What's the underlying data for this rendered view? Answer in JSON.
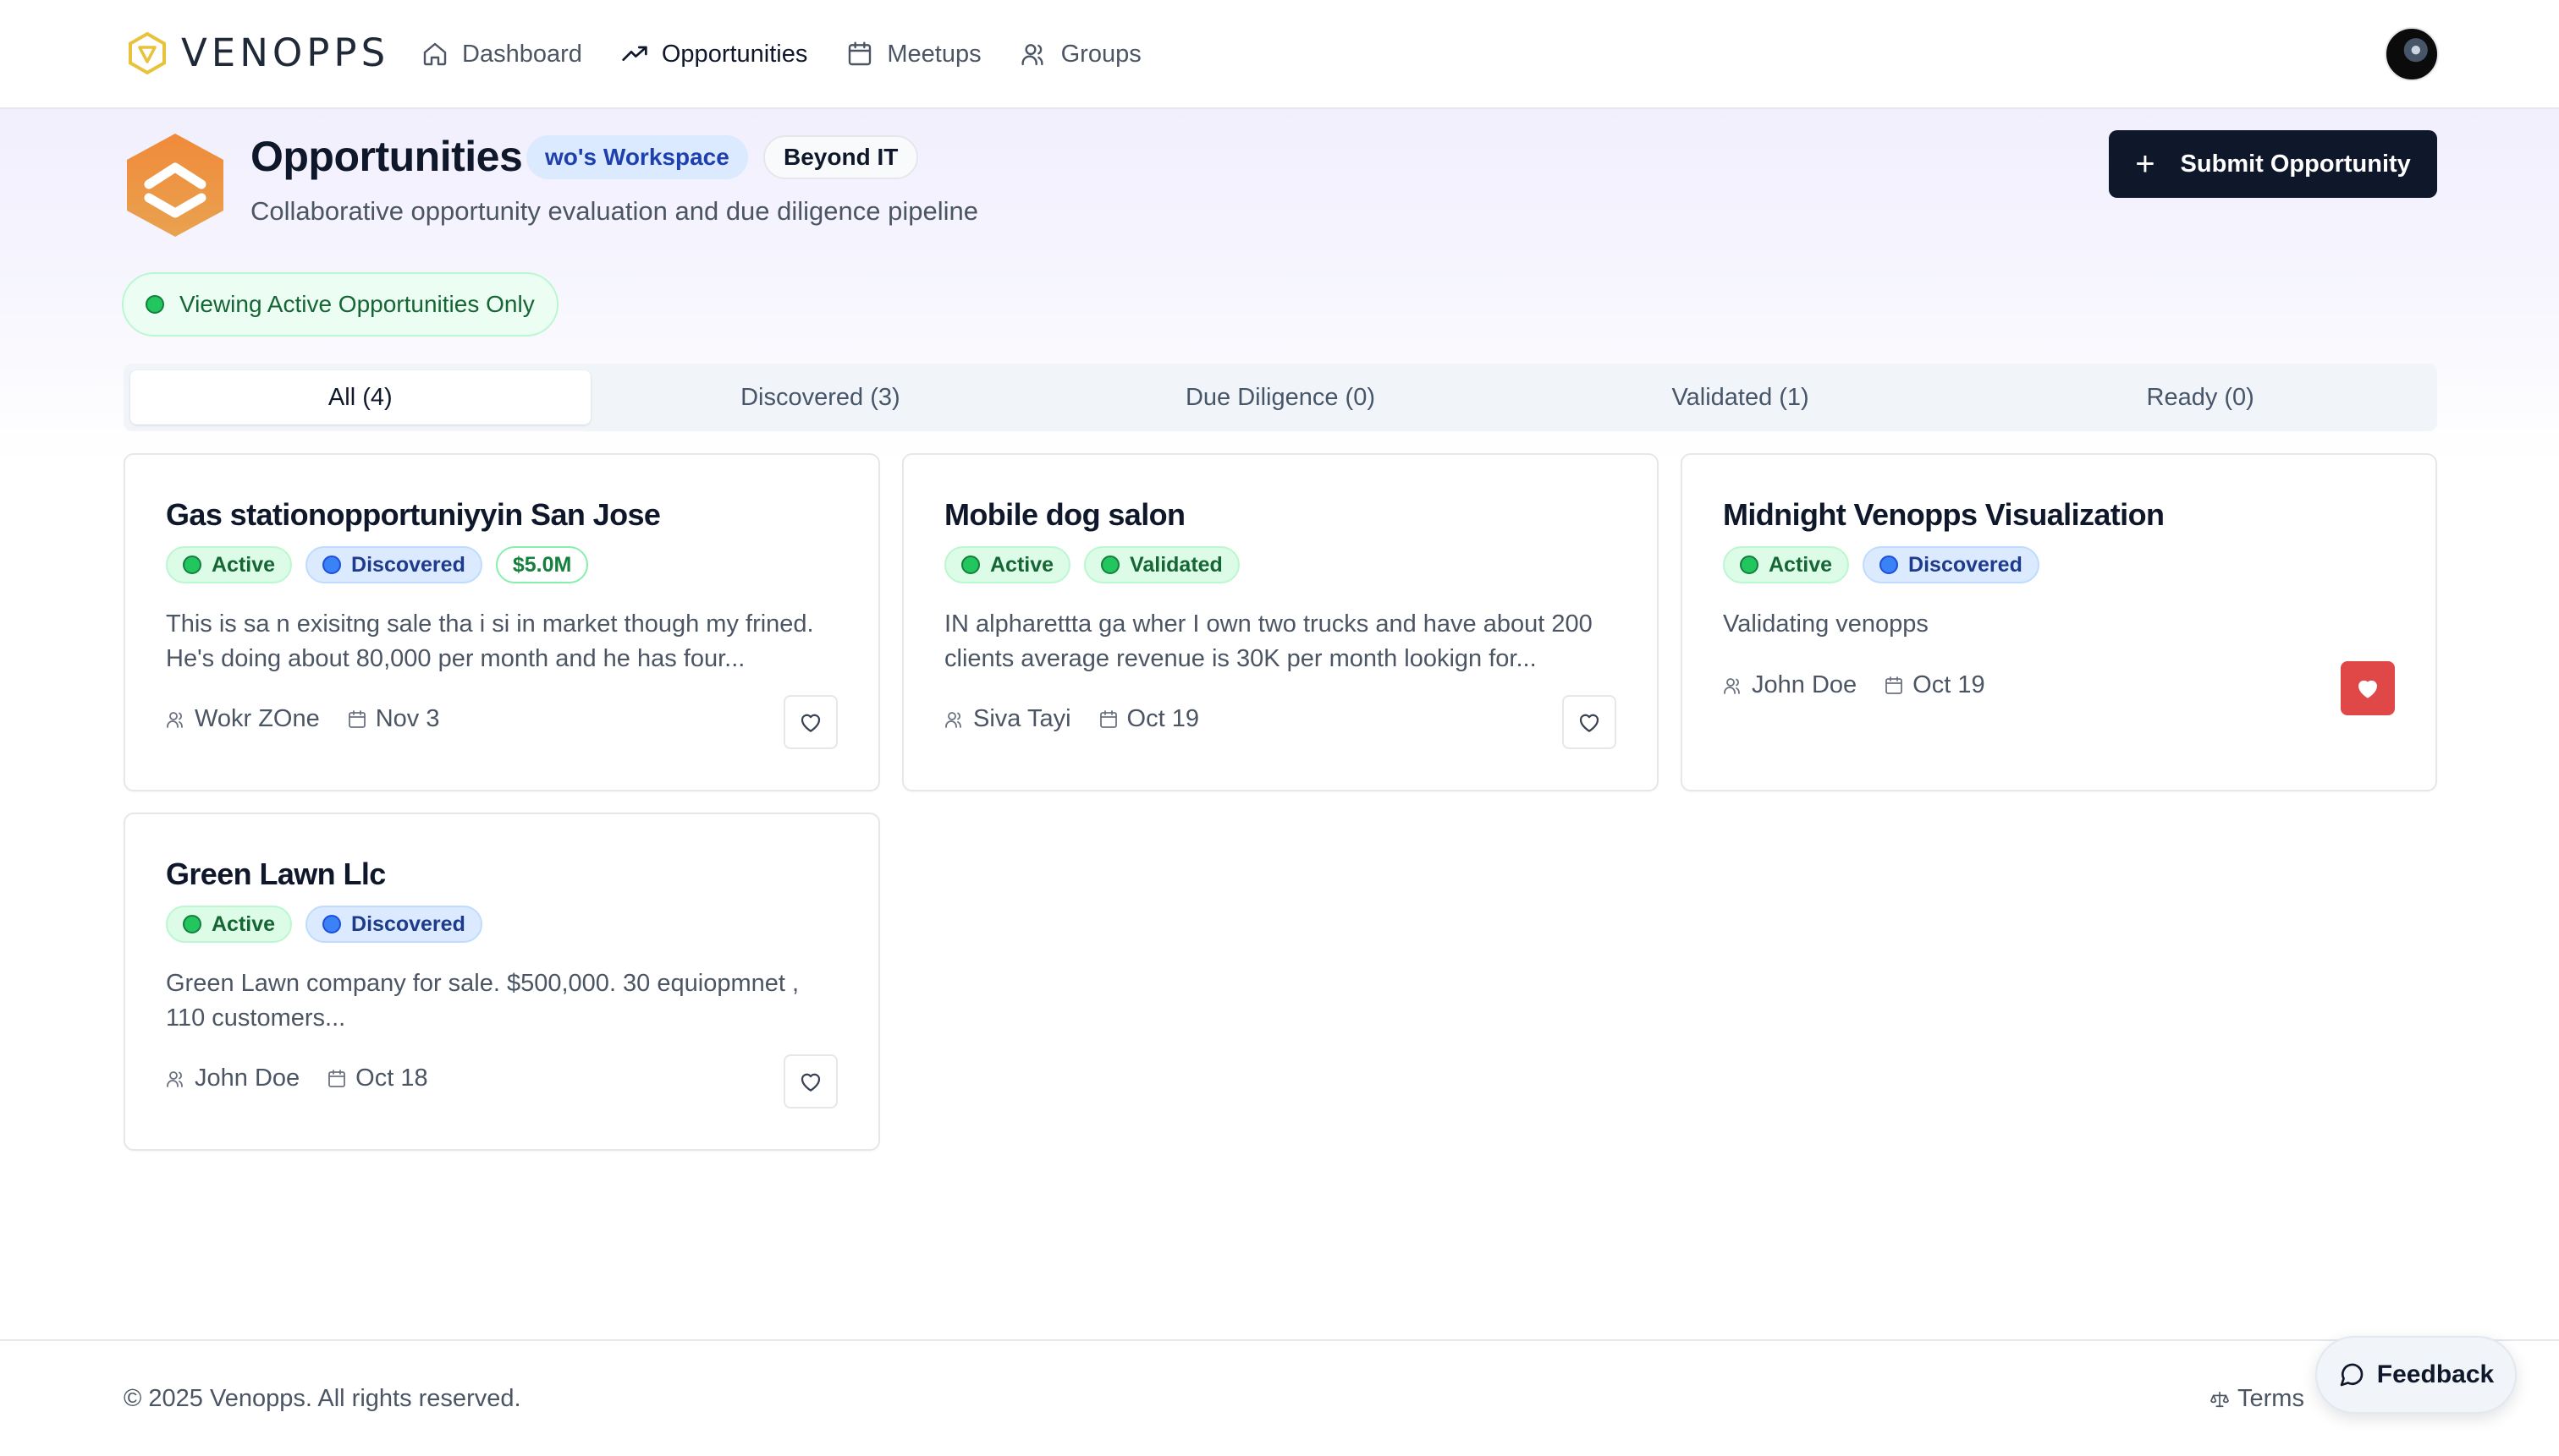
{
  "nav": {
    "brand": "VENOPPS",
    "links": [
      {
        "label": "Dashboard",
        "icon": "home-icon"
      },
      {
        "label": "Opportunities",
        "icon": "trending-up-icon"
      },
      {
        "label": "Meetups",
        "icon": "calendar-icon"
      },
      {
        "label": "Groups",
        "icon": "users-icon"
      }
    ],
    "active_link": "Opportunities"
  },
  "header": {
    "title": "Opportunities",
    "workspace_pill": "wo's Workspace",
    "group_pill": "Beyond IT",
    "subtitle": "Collaborative opportunity evaluation and due diligence pipeline",
    "submit_label": "Submit Opportunity",
    "status_chip": "Viewing Active Opportunities Only"
  },
  "tabs": [
    {
      "label": "All (4)",
      "active": true
    },
    {
      "label": "Discovered (3)",
      "active": false
    },
    {
      "label": "Due Diligence (0)",
      "active": false
    },
    {
      "label": "Validated (1)",
      "active": false
    },
    {
      "label": "Ready (0)",
      "active": false
    }
  ],
  "cards": [
    {
      "title": "Gas stationopportuniyyin San Jose",
      "badges": [
        {
          "label": "Active",
          "kind": "active"
        },
        {
          "label": "Discovered",
          "kind": "discovered"
        },
        {
          "label": "$5.0M",
          "kind": "amount"
        }
      ],
      "description": "This is sa n exisitng sale tha i si in market though my frined. He's doing about 80,000 per month and he has four...",
      "owner": "Wokr ZOne",
      "date": "Nov 3",
      "favorited": false
    },
    {
      "title": "Mobile dog salon",
      "badges": [
        {
          "label": "Active",
          "kind": "active"
        },
        {
          "label": "Validated",
          "kind": "validated"
        }
      ],
      "description": "IN alpharettta ga wher I own two trucks and have about 200 clients average revenue is 30K per month lookign for...",
      "owner": "Siva Tayi",
      "date": "Oct 19",
      "favorited": false
    },
    {
      "title": "Midnight Venopps Visualization",
      "badges": [
        {
          "label": "Active",
          "kind": "active"
        },
        {
          "label": "Discovered",
          "kind": "discovered"
        }
      ],
      "description": "Validating venopps",
      "owner": "John Doe",
      "date": "Oct 19",
      "favorited": true
    },
    {
      "title": "Green Lawn Llc",
      "badges": [
        {
          "label": "Active",
          "kind": "active"
        },
        {
          "label": "Discovered",
          "kind": "discovered"
        }
      ],
      "description": "Green Lawn company for sale. $500,000. 30 equiopmnet , 110 customers...",
      "owner": "John Doe",
      "date": "Oct 18",
      "favorited": false
    }
  ],
  "footer": {
    "copyright": "© 2025 Venopps. All rights reserved.",
    "terms": "Terms",
    "feedback": "Feedback"
  },
  "colors": {
    "primary": "#0f172a",
    "brand_orange": "#ee8a3c",
    "active_green": "#22c55e",
    "discovered_blue": "#3b82f6",
    "favorite_red": "#e04848"
  }
}
